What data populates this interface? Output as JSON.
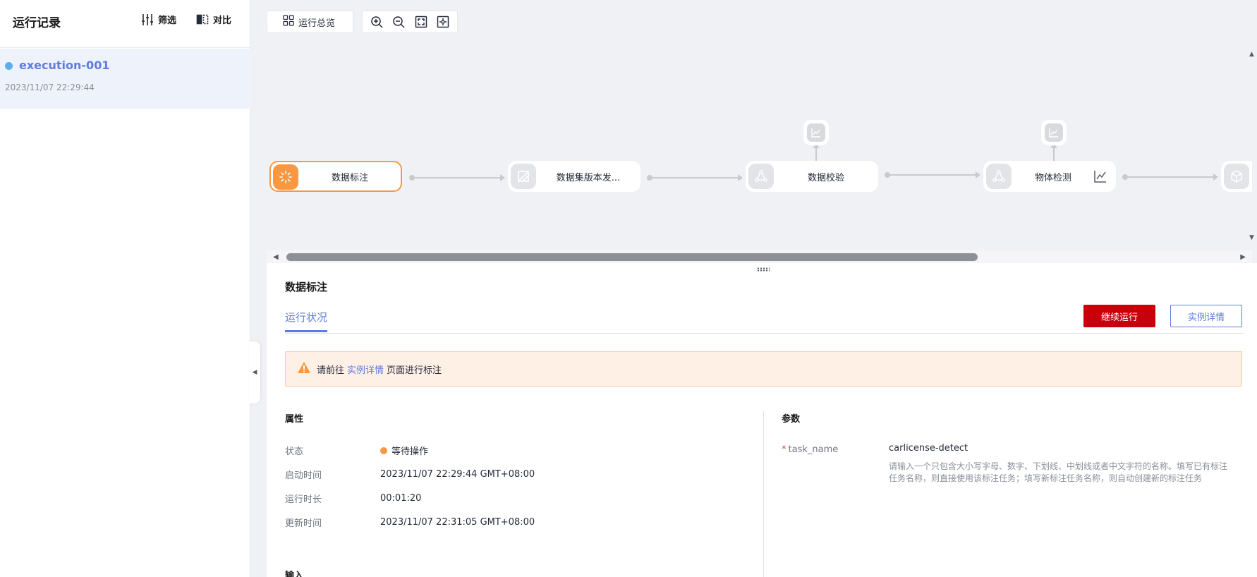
{
  "sidebar": {
    "title": "运行记录",
    "filter_label": "筛选",
    "compare_label": "对比",
    "runs": [
      {
        "name": "execution-001",
        "time": "2023/11/07 22:29:44"
      }
    ]
  },
  "toolbar": {
    "overview_label": "运行总览",
    "zoom_in": "zoom-in",
    "zoom_out": "zoom-out",
    "fit": "fit-screen",
    "center": "center"
  },
  "pipeline": {
    "nodes": [
      {
        "label": "数据标注",
        "state": "running"
      },
      {
        "label": "数据集版本发...",
        "state": "pending"
      },
      {
        "label": "数据校验",
        "state": "pending"
      },
      {
        "label": "物体检测",
        "state": "pending"
      }
    ]
  },
  "detail": {
    "title": "数据标注",
    "tab_label": "运行状况",
    "continue_label": "继续运行",
    "instance_label": "实例详情",
    "alert": {
      "prefix": "请前往",
      "link": "实例详情",
      "suffix": "页面进行标注"
    },
    "attr_title": "属性",
    "attrs": {
      "status_key": "状态",
      "status_val": "等待操作",
      "start_key": "启动时间",
      "start_val": "2023/11/07 22:29:44 GMT+08:00",
      "duration_key": "运行时长",
      "duration_val": "00:01:20",
      "update_key": "更新时间",
      "update_val": "2023/11/07 22:31:05 GMT+08:00"
    },
    "input_title": "输入",
    "param_title": "参数",
    "param": {
      "key": "task_name",
      "value": "carlicense-detect",
      "hint": "请输入一个只包含大小写字母、数字、下划线、中划线或者中文字符的名称。填写已有标注任务名称，则直接使用该标注任务；填写新标注任务名称，则自动创建新的标注任务"
    }
  },
  "colors": {
    "accent": "#5e7ce0",
    "primary_button": "#c7000b",
    "running": "#fa9841",
    "alert_bg": "#fff0e6"
  }
}
